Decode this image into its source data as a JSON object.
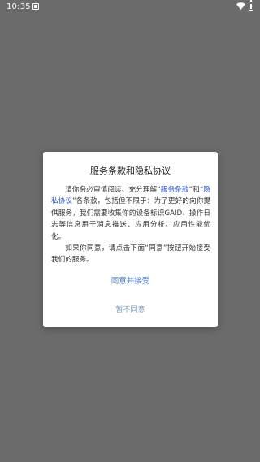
{
  "status_bar": {
    "time": "10:35",
    "icons": [
      "notification-icon",
      "wifi-icon",
      "battery-icon"
    ]
  },
  "dialog": {
    "title": "服务条款和隐私协议",
    "para1_before_link1": "请你务必审慎阅读、充分理解“",
    "link_terms": "服务条款",
    "para1_between_links": "”和“",
    "link_privacy": "隐私协议",
    "para1_after_links": "”各条款，包括但不限于：为了更好的向你提供服务，我们需要收集你的设备标识GAID、操作日志等信息用于消息推送、应用分析、应用性能优化。",
    "para2": "如果你同意，请点击下面“同意”按钮开始接受我们的服务。",
    "agree_label": "同意并接受",
    "disagree_label": "暂不同意"
  },
  "colors": {
    "overlay_background": "#6b6b6b",
    "link": "#2b56d8",
    "agree": "#4a7fd4",
    "disagree": "#7f9fc6"
  }
}
